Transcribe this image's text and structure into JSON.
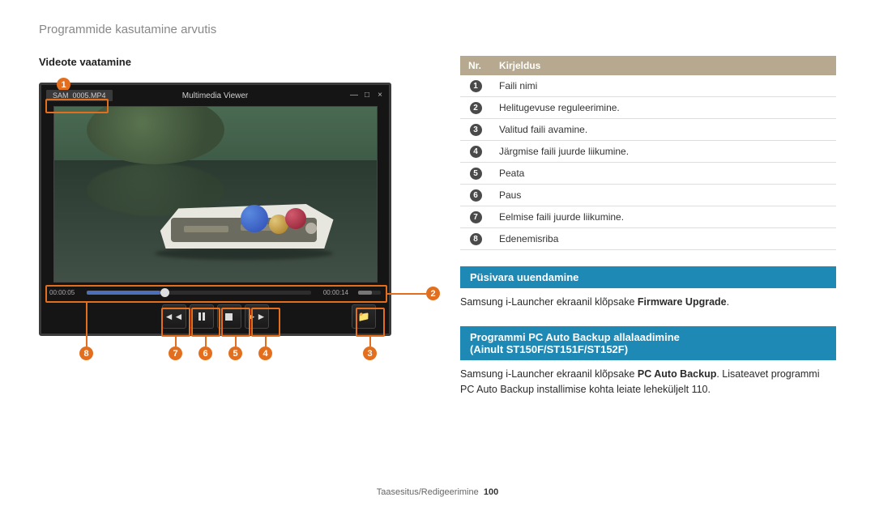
{
  "breadcrumb": "Programmide kasutamine arvutis",
  "left": {
    "heading": "Videote vaatamine",
    "player": {
      "filename": "SAM_0005.MP4",
      "title": "Multimedia Viewer",
      "time_current": "00:00:05",
      "time_total": "00:00:14"
    },
    "callouts": {
      "c1": "1",
      "c2": "2",
      "c3": "3",
      "c4": "4",
      "c5": "5",
      "c6": "6",
      "c7": "7",
      "c8": "8"
    }
  },
  "table": {
    "headers": {
      "nr": "Nr.",
      "kirj": "Kirjeldus"
    },
    "rows": [
      {
        "n": "1",
        "d": "Faili nimi"
      },
      {
        "n": "2",
        "d": "Helitugevuse reguleerimine."
      },
      {
        "n": "3",
        "d": "Valitud faili avamine."
      },
      {
        "n": "4",
        "d": "Järgmise faili juurde liikumine."
      },
      {
        "n": "5",
        "d": "Peata"
      },
      {
        "n": "6",
        "d": "Paus"
      },
      {
        "n": "7",
        "d": "Eelmise faili juurde liikumine."
      },
      {
        "n": "8",
        "d": "Edenemisriba"
      }
    ]
  },
  "sec1": {
    "title": "Püsivara uuendamine",
    "text_a": "Samsung i-Launcher ekraanil klõpsake ",
    "text_b": "Firmware Upgrade",
    "text_c": "."
  },
  "sec2": {
    "title_a": "Programmi PC Auto Backup allalaadimine",
    "title_b": "(Ainult ST150F/ST151F/ST152F)",
    "text_a": "Samsung i-Launcher ekraanil klõpsake ",
    "text_b": "PC Auto Backup",
    "text_c": ". Lisateavet programmi PC Auto Backup installimise kohta leiate leheküljelt 110."
  },
  "footer": {
    "section": "Taasesitus/Redigeerimine",
    "page": "100"
  }
}
